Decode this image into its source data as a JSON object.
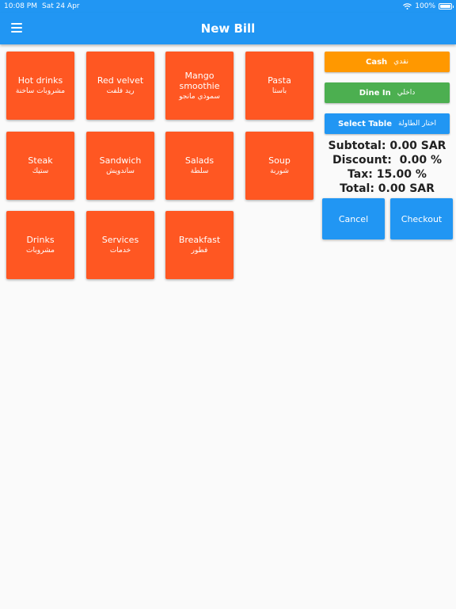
{
  "status_bar": {
    "time": "10:08 PM",
    "date": "Sat 24 Apr",
    "battery": "100%",
    "battery_level": 1.0
  },
  "app_bar": {
    "title": "New Bill"
  },
  "categories": [
    {
      "en": "Hot drinks",
      "ar": "مشروبات ساخنة"
    },
    {
      "en": "Red velvet",
      "ar": "ريد فلفت"
    },
    {
      "en": "Mango smoothie",
      "ar": "سموذي مانجو"
    },
    {
      "en": "Pasta",
      "ar": "باستا"
    },
    {
      "en": "Steak",
      "ar": "ستيك"
    },
    {
      "en": "Sandwich",
      "ar": "ساندويش"
    },
    {
      "en": "Salads",
      "ar": "سلطة"
    },
    {
      "en": "Soup",
      "ar": "شوربة"
    },
    {
      "en": "Drinks",
      "ar": "مشروبات"
    },
    {
      "en": "Services",
      "ar": "خدمات"
    },
    {
      "en": "Breakfast",
      "ar": "فطور"
    }
  ],
  "options": {
    "payment": {
      "en": "Cash",
      "ar": "نقدي",
      "color": "#ff9800"
    },
    "order_type": {
      "en": "Dine In",
      "ar": "داخلي",
      "color": "#4caf50"
    },
    "table": {
      "en": "Select Table",
      "ar": "اختار الطاولة",
      "color": "#2196f3"
    }
  },
  "summary": {
    "subtotal": "Subtotal: 0.00 SAR",
    "discount": "Discount:  0.00 %",
    "tax": "Tax: 15.00 %",
    "total": "Total: 0.00 SAR"
  },
  "actions": {
    "cancel": "Cancel",
    "checkout": "Checkout"
  },
  "colors": {
    "primary": "#2196f3",
    "tile": "#ff5722"
  }
}
